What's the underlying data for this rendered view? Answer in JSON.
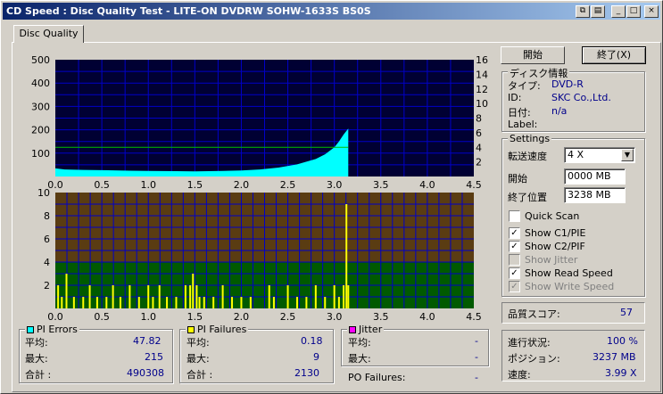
{
  "window": {
    "title": "CD Speed : Disc Quality Test - LITE-ON DVDRW SOHW-1633S BS0S"
  },
  "tab": {
    "label": "Disc Quality"
  },
  "buttons": {
    "start": "開始",
    "stop": "終了(X)"
  },
  "disc_info": {
    "title": "ディスク情報",
    "type_label": "タイプ:",
    "type_value": "DVD-R",
    "id_label": "ID:",
    "id_value": "SKC Co.,Ltd.",
    "date_label": "日付:",
    "date_value": "n/a",
    "label_label": "Label:",
    "label_value": ""
  },
  "settings": {
    "title": "Settings",
    "speed_label": "転送速度",
    "speed_value": "4 X",
    "start_label": "開始",
    "start_value": "0000 MB",
    "end_label": "終了位置",
    "end_value": "3238 MB",
    "quick_scan": "Quick Scan",
    "show_c1": "Show C1/PIE",
    "show_c2": "Show C2/PIF",
    "show_jitter": "Show Jitter",
    "show_read": "Show Read Speed",
    "show_write": "Show Write Speed"
  },
  "quality": {
    "label": "品質スコア:",
    "value": "57"
  },
  "progress": {
    "progress_label": "進行状況:",
    "progress_value": "100 %",
    "position_label": "ポジション:",
    "position_value": "3237 MB",
    "speed_label": "速度:",
    "speed_value": "3.99 X"
  },
  "pi_errors": {
    "title": "PI Errors",
    "avg_label": "平均:",
    "avg": "47.82",
    "max_label": "最大:",
    "max": "215",
    "total_label": "合計 :",
    "total": "490308"
  },
  "pi_failures": {
    "title": "PI Failures",
    "avg_label": "平均:",
    "avg": "0.18",
    "max_label": "最大:",
    "max": "9",
    "total_label": "合計 :",
    "total": "2130"
  },
  "jitter": {
    "title": "Jitter",
    "avg_label": "平均:",
    "avg": "-",
    "max_label": "最大:",
    "max": "-"
  },
  "po_failures": {
    "label": "PO Failures:",
    "value": "-"
  },
  "colors": {
    "chart_bg": "#000033",
    "grid": "#0000c8",
    "pie": "#00ffff",
    "pif": "#ffff00",
    "speed": "#00c000",
    "band_brown": "#5a3c12",
    "band_green": "#005a00"
  },
  "chart_data": [
    {
      "type": "area",
      "x_ticks": [
        "0.0",
        "0.5",
        "1.0",
        "1.5",
        "2.0",
        "2.5",
        "3.0",
        "3.5",
        "4.0",
        "4.5"
      ],
      "y_ticks_left": [
        "100",
        "200",
        "300",
        "400",
        "500"
      ],
      "y_ticks_right": [
        "2",
        "4",
        "6",
        "8",
        "10",
        "12",
        "14",
        "16"
      ],
      "xlim": [
        0,
        4.5
      ],
      "ylim": [
        0,
        500
      ],
      "y2lim": [
        0,
        16
      ],
      "series": [
        {
          "values_x": [
            0,
            0.1,
            0.3,
            0.5,
            0.8,
            1.0,
            1.3,
            1.5,
            1.8,
            2.0,
            2.2,
            2.4,
            2.6,
            2.8,
            2.9,
            3.0,
            3.05,
            3.1,
            3.15
          ],
          "values_y": [
            35,
            30,
            28,
            27,
            25,
            24,
            23,
            22,
            24,
            26,
            30,
            38,
            52,
            75,
            95,
            125,
            150,
            180,
            205
          ]
        },
        {
          "values_x": [
            0,
            3.15
          ],
          "values_y": [
            4,
            4
          ]
        }
      ]
    },
    {
      "type": "bar",
      "x_ticks": [
        "0.0",
        "0.5",
        "1.0",
        "1.5",
        "2.0",
        "2.5",
        "3.0",
        "3.5",
        "4.0",
        "4.5"
      ],
      "y_ticks": [
        "2",
        "4",
        "6",
        "8",
        "10"
      ],
      "xlim": [
        0,
        4.5
      ],
      "ylim": [
        0,
        10
      ],
      "series": [
        {
          "values_x": [
            0.03,
            0.07,
            0.12,
            0.2,
            0.3,
            0.37,
            0.45,
            0.55,
            0.62,
            0.7,
            0.8,
            0.9,
            1.0,
            1.05,
            1.12,
            1.2,
            1.3,
            1.4,
            1.45,
            1.48,
            1.52,
            1.55,
            1.6,
            1.7,
            1.8,
            1.9,
            2.0,
            2.1,
            2.3,
            2.35,
            2.5,
            2.6,
            2.7,
            2.8,
            2.9,
            3.0,
            3.05,
            3.1,
            3.13,
            3.15
          ],
          "values_y": [
            2,
            1,
            3,
            1,
            1,
            2,
            1,
            1,
            2,
            1,
            2,
            1,
            2,
            1,
            2,
            1,
            1,
            2,
            2,
            3,
            2,
            1,
            1,
            1,
            2,
            1,
            1,
            1,
            2,
            1,
            2,
            1,
            1,
            2,
            1,
            2,
            1,
            2,
            9,
            2
          ]
        }
      ]
    }
  ]
}
